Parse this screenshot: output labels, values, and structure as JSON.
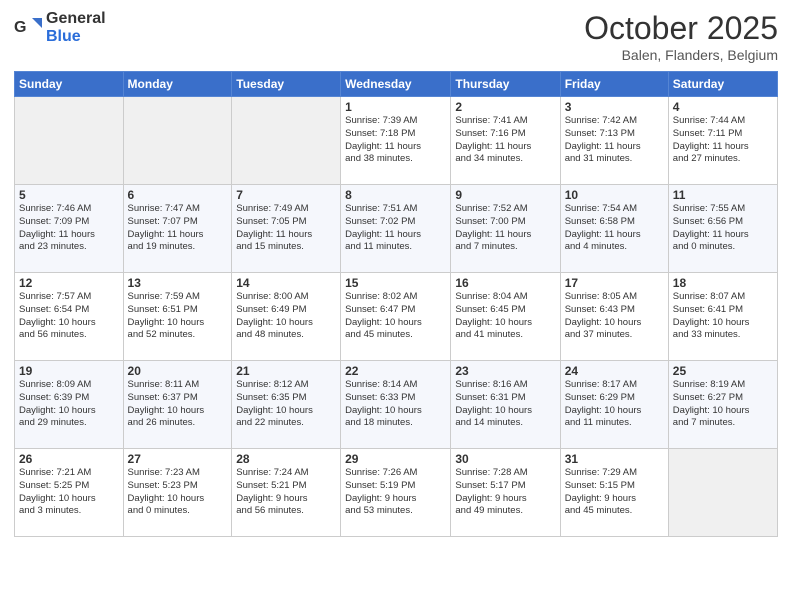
{
  "header": {
    "logo_general": "General",
    "logo_blue": "Blue",
    "month_title": "October 2025",
    "location": "Balen, Flanders, Belgium"
  },
  "days_of_week": [
    "Sunday",
    "Monday",
    "Tuesday",
    "Wednesday",
    "Thursday",
    "Friday",
    "Saturday"
  ],
  "weeks": [
    [
      {
        "day": "",
        "info": ""
      },
      {
        "day": "",
        "info": ""
      },
      {
        "day": "",
        "info": ""
      },
      {
        "day": "1",
        "info": "Sunrise: 7:39 AM\nSunset: 7:18 PM\nDaylight: 11 hours\nand 38 minutes."
      },
      {
        "day": "2",
        "info": "Sunrise: 7:41 AM\nSunset: 7:16 PM\nDaylight: 11 hours\nand 34 minutes."
      },
      {
        "day": "3",
        "info": "Sunrise: 7:42 AM\nSunset: 7:13 PM\nDaylight: 11 hours\nand 31 minutes."
      },
      {
        "day": "4",
        "info": "Sunrise: 7:44 AM\nSunset: 7:11 PM\nDaylight: 11 hours\nand 27 minutes."
      }
    ],
    [
      {
        "day": "5",
        "info": "Sunrise: 7:46 AM\nSunset: 7:09 PM\nDaylight: 11 hours\nand 23 minutes."
      },
      {
        "day": "6",
        "info": "Sunrise: 7:47 AM\nSunset: 7:07 PM\nDaylight: 11 hours\nand 19 minutes."
      },
      {
        "day": "7",
        "info": "Sunrise: 7:49 AM\nSunset: 7:05 PM\nDaylight: 11 hours\nand 15 minutes."
      },
      {
        "day": "8",
        "info": "Sunrise: 7:51 AM\nSunset: 7:02 PM\nDaylight: 11 hours\nand 11 minutes."
      },
      {
        "day": "9",
        "info": "Sunrise: 7:52 AM\nSunset: 7:00 PM\nDaylight: 11 hours\nand 7 minutes."
      },
      {
        "day": "10",
        "info": "Sunrise: 7:54 AM\nSunset: 6:58 PM\nDaylight: 11 hours\nand 4 minutes."
      },
      {
        "day": "11",
        "info": "Sunrise: 7:55 AM\nSunset: 6:56 PM\nDaylight: 11 hours\nand 0 minutes."
      }
    ],
    [
      {
        "day": "12",
        "info": "Sunrise: 7:57 AM\nSunset: 6:54 PM\nDaylight: 10 hours\nand 56 minutes."
      },
      {
        "day": "13",
        "info": "Sunrise: 7:59 AM\nSunset: 6:51 PM\nDaylight: 10 hours\nand 52 minutes."
      },
      {
        "day": "14",
        "info": "Sunrise: 8:00 AM\nSunset: 6:49 PM\nDaylight: 10 hours\nand 48 minutes."
      },
      {
        "day": "15",
        "info": "Sunrise: 8:02 AM\nSunset: 6:47 PM\nDaylight: 10 hours\nand 45 minutes."
      },
      {
        "day": "16",
        "info": "Sunrise: 8:04 AM\nSunset: 6:45 PM\nDaylight: 10 hours\nand 41 minutes."
      },
      {
        "day": "17",
        "info": "Sunrise: 8:05 AM\nSunset: 6:43 PM\nDaylight: 10 hours\nand 37 minutes."
      },
      {
        "day": "18",
        "info": "Sunrise: 8:07 AM\nSunset: 6:41 PM\nDaylight: 10 hours\nand 33 minutes."
      }
    ],
    [
      {
        "day": "19",
        "info": "Sunrise: 8:09 AM\nSunset: 6:39 PM\nDaylight: 10 hours\nand 29 minutes."
      },
      {
        "day": "20",
        "info": "Sunrise: 8:11 AM\nSunset: 6:37 PM\nDaylight: 10 hours\nand 26 minutes."
      },
      {
        "day": "21",
        "info": "Sunrise: 8:12 AM\nSunset: 6:35 PM\nDaylight: 10 hours\nand 22 minutes."
      },
      {
        "day": "22",
        "info": "Sunrise: 8:14 AM\nSunset: 6:33 PM\nDaylight: 10 hours\nand 18 minutes."
      },
      {
        "day": "23",
        "info": "Sunrise: 8:16 AM\nSunset: 6:31 PM\nDaylight: 10 hours\nand 14 minutes."
      },
      {
        "day": "24",
        "info": "Sunrise: 8:17 AM\nSunset: 6:29 PM\nDaylight: 10 hours\nand 11 minutes."
      },
      {
        "day": "25",
        "info": "Sunrise: 8:19 AM\nSunset: 6:27 PM\nDaylight: 10 hours\nand 7 minutes."
      }
    ],
    [
      {
        "day": "26",
        "info": "Sunrise: 7:21 AM\nSunset: 5:25 PM\nDaylight: 10 hours\nand 3 minutes."
      },
      {
        "day": "27",
        "info": "Sunrise: 7:23 AM\nSunset: 5:23 PM\nDaylight: 10 hours\nand 0 minutes."
      },
      {
        "day": "28",
        "info": "Sunrise: 7:24 AM\nSunset: 5:21 PM\nDaylight: 9 hours\nand 56 minutes."
      },
      {
        "day": "29",
        "info": "Sunrise: 7:26 AM\nSunset: 5:19 PM\nDaylight: 9 hours\nand 53 minutes."
      },
      {
        "day": "30",
        "info": "Sunrise: 7:28 AM\nSunset: 5:17 PM\nDaylight: 9 hours\nand 49 minutes."
      },
      {
        "day": "31",
        "info": "Sunrise: 7:29 AM\nSunset: 5:15 PM\nDaylight: 9 hours\nand 45 minutes."
      },
      {
        "day": "",
        "info": ""
      }
    ]
  ]
}
